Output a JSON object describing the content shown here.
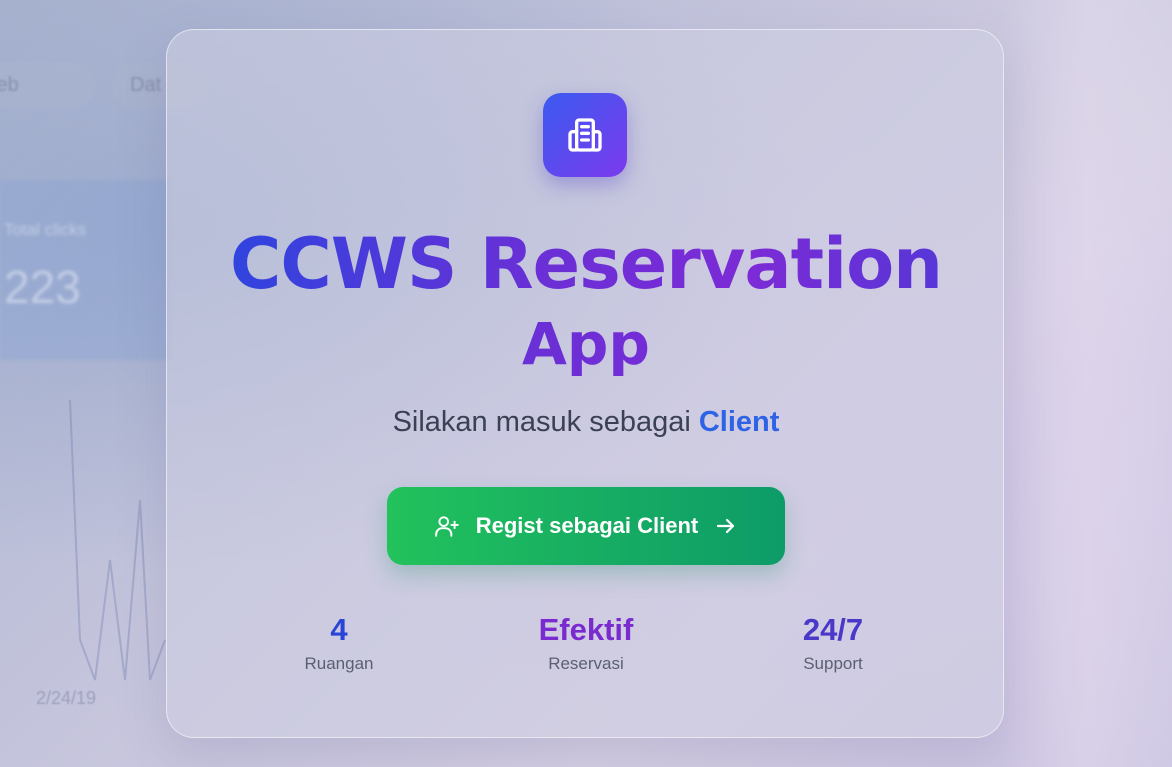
{
  "background": {
    "pills": [
      "Web",
      "Dat"
    ],
    "card_label": "Total clicks",
    "card_value": "223",
    "date": "2/24/19"
  },
  "app": {
    "logo_icon": "building-icon",
    "title_line1": "CCWS Reservation",
    "title_line2": "App",
    "subtitle_prefix": "Silakan masuk sebagai",
    "subtitle_highlight": "Client"
  },
  "cta": {
    "label": "Regist sebagai Client",
    "icon_left": "user-plus-icon",
    "icon_right": "arrow-right-icon"
  },
  "stats": [
    {
      "value": "4",
      "label": "Ruangan",
      "color": "#2a45d6"
    },
    {
      "value": "Efektif",
      "label": "Reservasi",
      "color": "#7a2bd0"
    },
    {
      "value": "24/7",
      "label": "Support",
      "color": "#4a38c8"
    }
  ],
  "colors": {
    "brand_blue": "#2448e0",
    "brand_purple": "#7c3aed",
    "cta_green": "#22c25c",
    "highlight": "#2f63e6"
  }
}
